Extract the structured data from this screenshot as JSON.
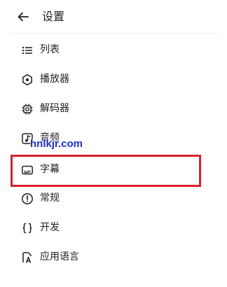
{
  "header": {
    "title": "设置",
    "back_icon": "arrow-left-icon"
  },
  "menu": {
    "items": [
      {
        "label": "列表",
        "icon": "list-icon"
      },
      {
        "label": "播放器",
        "icon": "hexagon-dot-icon"
      },
      {
        "label": "解码器",
        "icon": "chip-icon"
      },
      {
        "label": "音频",
        "icon": "music-note-icon"
      },
      {
        "label": "字幕",
        "icon": "subtitles-icon",
        "highlighted": true
      },
      {
        "label": "常规",
        "icon": "info-circle-icon"
      },
      {
        "label": "开发",
        "icon": "code-braces-icon"
      },
      {
        "label": "应用语言",
        "icon": "language-icon"
      }
    ]
  },
  "watermark": {
    "text": "hnlkjr.com",
    "color": "#1b2fd1"
  },
  "colors": {
    "highlight": "#d9232a",
    "text": "#1f1f1f",
    "background": "#ffffff"
  }
}
